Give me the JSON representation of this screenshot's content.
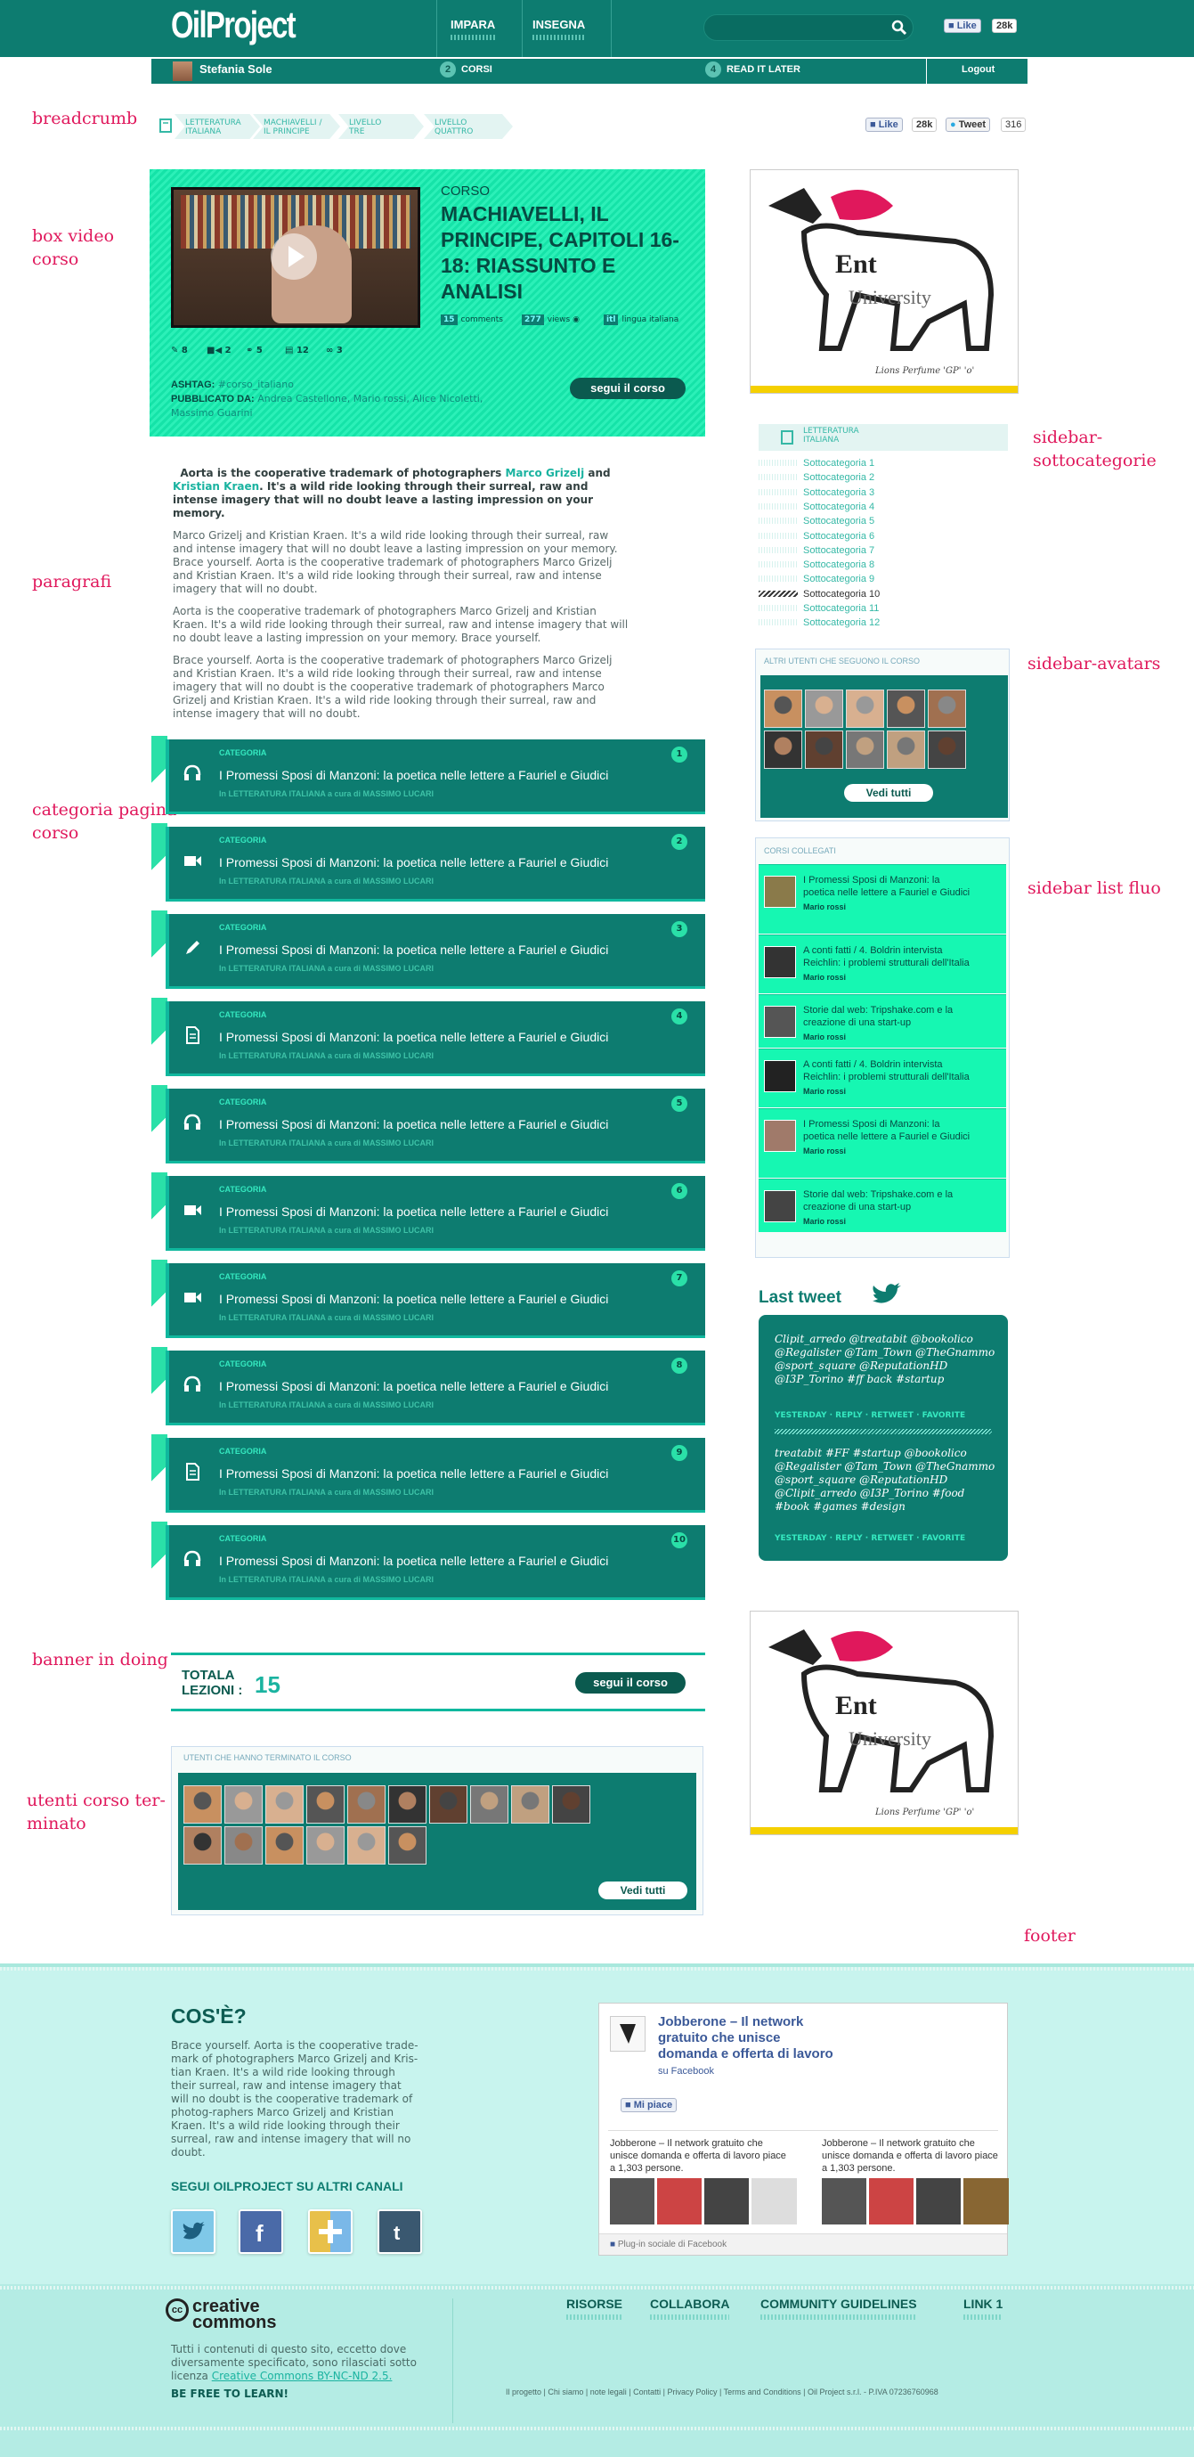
{
  "labels": {
    "breadcrumb": "breadcrumb",
    "box_video": "box video\ncorso",
    "paragrafi": "paragrafi",
    "categoria": "categoria pagina\ncorso",
    "banner": "banner in doing",
    "utenti": "utenti corso ter-\nminato",
    "sidebar_sotto": "sidebar-\nsottocategorie",
    "sidebar_avatars": "sidebar-avatars",
    "sidebar_list": "sidebar list fluo",
    "footer": "footer"
  },
  "header": {
    "logo": "OilProject",
    "nav": [
      "IMPARA",
      "INSEGNA"
    ],
    "fb_like": "Like",
    "fb_count": "28k"
  },
  "userbar": {
    "name": "Stefania Sole",
    "corsi_count": "2",
    "corsi": "CORSI",
    "later_count": "4",
    "later": "READ IT LATER",
    "logout": "Logout"
  },
  "breadcrumb": [
    "LETTERATURA\nITALIANA",
    "MACHIAVELLI /\nIL PRINCIPE",
    "LIVELLO\nTRE",
    "LIVELLO\nQUATTRO"
  ],
  "share": {
    "like": "Like",
    "like_count": "28k",
    "tweet": "Tweet",
    "tweet_count": "316"
  },
  "video": {
    "kicker": "CORSO",
    "title": "MACHIAVELLI, IL PRINCIPE, CAPITOLI 16-18: RIASSUNTO E ANALISI",
    "comments_n": "15",
    "comments": "comments",
    "views_n": "277",
    "views": "views",
    "lang_n": "itl",
    "lang": "lingua italiana",
    "counts": [
      "8",
      "2",
      "5",
      "12",
      "3"
    ],
    "ashtag_label": "ASHTAG:",
    "ashtag": "#corso_italiano",
    "pub_label": "PUBBLICATO DA:",
    "pub": "Andrea Castellone, Mario rossi, Alice Nicoletti, Massimo Guarini",
    "segui": "segui il corso"
  },
  "paragraphs": {
    "lead_a": "Aorta is the cooperative trademark of photographers ",
    "lead_n1": "Marco Grizelj",
    "lead_b": " and ",
    "lead_n2": "Kristian Kraen",
    "lead_c": ". It's a wild ride looking through their surreal, raw and intense imagery that will no doubt leave a lasting impression on your memory.",
    "p1": "Marco Grizelj and Kristian Kraen. It's a wild ride looking through their surreal, raw and intense imagery that will no doubt leave a lasting impression on your memory. Brace yourself. Aorta is the cooperative trademark of photographers Marco Grizelj and Kristian Kraen. It's a wild ride looking through their surreal, raw and intense imagery that will no doubt.",
    "p2": "Aorta is the cooperative trademark of photographers Marco Grizelj and Kristian Kraen. It's a wild ride looking through their surreal, raw and intense imagery that will no doubt leave a lasting impression on your memory. Brace yourself.",
    "p3": "Brace yourself. Aorta is the cooperative trademark of photographers Marco Grizelj and Kristian Kraen. It's a wild ride looking through their surreal, raw and intense imagery that will no doubt is the cooperative trademark of photographers Marco Grizelj and Kristian Kraen. It's a wild ride looking through their surreal, raw and intense imagery that will no doubt."
  },
  "categories": [
    {
      "kind": "CATEGORIA",
      "title": "I Promessi Sposi di Manzoni: la poetica nelle lettere a Fauriel e Giudici",
      "sub": "In LETTERATURA ITALIANA a cura di MASSIMO LUCARI",
      "num": "1",
      "icon": "headphones-icon"
    },
    {
      "kind": "CATEGORIA",
      "title": "I Promessi Sposi di Manzoni: la poetica nelle lettere a Fauriel e Giudici",
      "sub": "In LETTERATURA ITALIANA a cura di MASSIMO LUCARI",
      "num": "2",
      "icon": "video-camera-icon"
    },
    {
      "kind": "CATEGORIA",
      "title": "I Promessi Sposi di Manzoni: la poetica nelle lettere a Fauriel e Giudici",
      "sub": "In LETTERATURA ITALIANA a cura di MASSIMO LUCARI",
      "num": "3",
      "icon": "pencil-icon"
    },
    {
      "kind": "CATEGORIA",
      "title": "I Promessi Sposi di Manzoni: la poetica nelle lettere a Fauriel e Giudici",
      "sub": "In LETTERATURA ITALIANA a cura di MASSIMO LUCARI",
      "num": "4",
      "icon": "document-icon"
    },
    {
      "kind": "CATEGORIA",
      "title": "I Promessi Sposi di Manzoni: la poetica nelle lettere a Fauriel e Giudici",
      "sub": "In LETTERATURA ITALIANA a cura di MASSIMO LUCARI",
      "num": "5",
      "icon": "headphones-icon"
    },
    {
      "kind": "CATEGORIA",
      "title": "I Promessi Sposi di Manzoni: la poetica nelle lettere a Fauriel e Giudici",
      "sub": "In LETTERATURA ITALIANA a cura di MASSIMO LUCARI",
      "num": "6",
      "icon": "video-camera-icon"
    },
    {
      "kind": "CATEGORIA",
      "title": "I Promessi Sposi di Manzoni: la poetica nelle lettere a Fauriel e Giudici",
      "sub": "In LETTERATURA ITALIANA a cura di MASSIMO LUCARI",
      "num": "7",
      "icon": "video-camera-icon"
    },
    {
      "kind": "CATEGORIA",
      "title": "I Promessi Sposi di Manzoni: la poetica nelle lettere a Fauriel e Giudici",
      "sub": "In LETTERATURA ITALIANA a cura di MASSIMO LUCARI",
      "num": "8",
      "icon": "headphones-icon"
    },
    {
      "kind": "CATEGORIA",
      "title": "I Promessi Sposi di Manzoni: la poetica nelle lettere a Fauriel e Giudici",
      "sub": "In LETTERATURA ITALIANA a cura di MASSIMO LUCARI",
      "num": "9",
      "icon": "document-icon"
    },
    {
      "kind": "CATEGORIA",
      "title": "I Promessi Sposi di Manzoni: la poetica nelle lettere a Fauriel e Giudici",
      "sub": "In LETTERATURA ITALIANA a cura di MASSIMO LUCARI",
      "num": "10",
      "icon": "headphones-icon"
    }
  ],
  "total": {
    "label": "TOTALA\nLEZIONI :",
    "value": "15",
    "segui": "segui il corso"
  },
  "finished": {
    "head": "UTENTI CHE HANNO TERMINATO IL CORSO",
    "vedi": "Vedi tutti"
  },
  "poster": {
    "script": "Lions Perfume 'GP' 'o'"
  },
  "subcats": {
    "head": "LETTERATURA\nITALIANA",
    "items": [
      "Sottocategoria 1",
      "Sottocategoria 2",
      "Sottocategoria 3",
      "Sottocategoria 4",
      "Sottocategoria 5",
      "Sottocategoria 6",
      "Sottocategoria 7",
      "Sottocategoria 8",
      "Sottocategoria 9",
      "Sottocategoria 10",
      "Sottocategoria 11",
      "Sottocategoria 12"
    ],
    "active_index": 9
  },
  "sidebar_avatars": {
    "head": "ALTRI UTENTI CHE SEGUONO IL CORSO",
    "vedi": "Vedi tutti"
  },
  "related": {
    "head": "CORSI COLLEGATI",
    "items": [
      {
        "title": "I Promessi Sposi di Manzoni: la poetica nelle lettere a Fauriel e Giudici",
        "author": "Mario rossi"
      },
      {
        "title": "A conti fatti / 4. Boldrin intervista Reichlin: i problemi strutturali dell'Italia",
        "author": "Mario rossi"
      },
      {
        "title": "Storie dal web: Tripshake.com e la creazione di una start-up",
        "author": "Mario rossi"
      },
      {
        "title": "A conti fatti / 4. Boldrin intervista Reichlin: i problemi strutturali dell'Italia",
        "author": "Mario rossi"
      },
      {
        "title": "I Promessi Sposi di Manzoni: la poetica nelle lettere a Fauriel e Giudici",
        "author": "Mario rossi"
      },
      {
        "title": "Storie dal web: Tripshake.com e la creazione di una start-up",
        "author": "Mario rossi"
      }
    ]
  },
  "tweets": {
    "title": "Last tweet",
    "t1": "Clipit_arredo @treatabit @bookolico @Regalister @Tam_Town @TheGnammo @sport_square @ReputationHD @I3P_Torino #ff back #startup",
    "a1": "YESTERDAY · REPLY · RETWEET · FAVORITE",
    "t2": "treatabit #FF #startup @bookolico @Regalister @Tam_Town @TheGnammo @sport_square @ReputationHD @Clipit_arredo @I3P_Torino #food #book #games #design",
    "a2": "YESTERDAY · REPLY · RETWEET · FAVORITE"
  },
  "footer": {
    "cose": "COS'È?",
    "cose_text": "Brace yourself. Aorta is the cooperative trade-mark of photographers Marco Grizelj and Kris-tian Kraen. It's a wild ride looking through their surreal, raw and intense imagery that will no doubt is the cooperative trademark of photog-raphers Marco Grizelj and Kristian Kraen. It's a wild ride looking through their surreal, raw and intense imagery that will no doubt.",
    "segui": "SEGUI OILPROJECT SU ALTRI CANALI",
    "fb_title": "Jobberone – Il network gratuito che unisce domanda e offerta di lavoro",
    "fb_on": "su Facebook",
    "fb_mi": "Mi piace",
    "fb_c1": "Jobberone – Il network gratuito che unisce domanda e offerta di lavoro piace a 1,303 persone.",
    "fb_c2": "Jobberone – Il network gratuito che unisce domanda e offerta di lavoro piace a 1,303 persone.",
    "fb_plugin": "Plug-in sociale di Facebook",
    "cc_logo": "creative\ncommons",
    "cc_text": "Tutti i contenuti di questo sito, eccetto dove diversamente specificato, sono rilasciati sotto licenza ",
    "cc_link": "Creative Commons BY-NC-ND 2.5.",
    "cc_free": "BE FREE TO LEARN!",
    "links": [
      "RISORSE",
      "COLLABORA",
      "COMMUNITY GUIDELINES",
      "LINK 1"
    ],
    "bottom": "Il progetto | Chi siamo | note legali | Contatti | Privacy Policy | Terms and Conditions | Oil Project s.r.l. - P.IVA 07236760968"
  },
  "colors": {
    "brand": "#0d7c70",
    "fluo": "#16f7b2",
    "accent": "#1ab3a0",
    "label": "#e0185c"
  }
}
